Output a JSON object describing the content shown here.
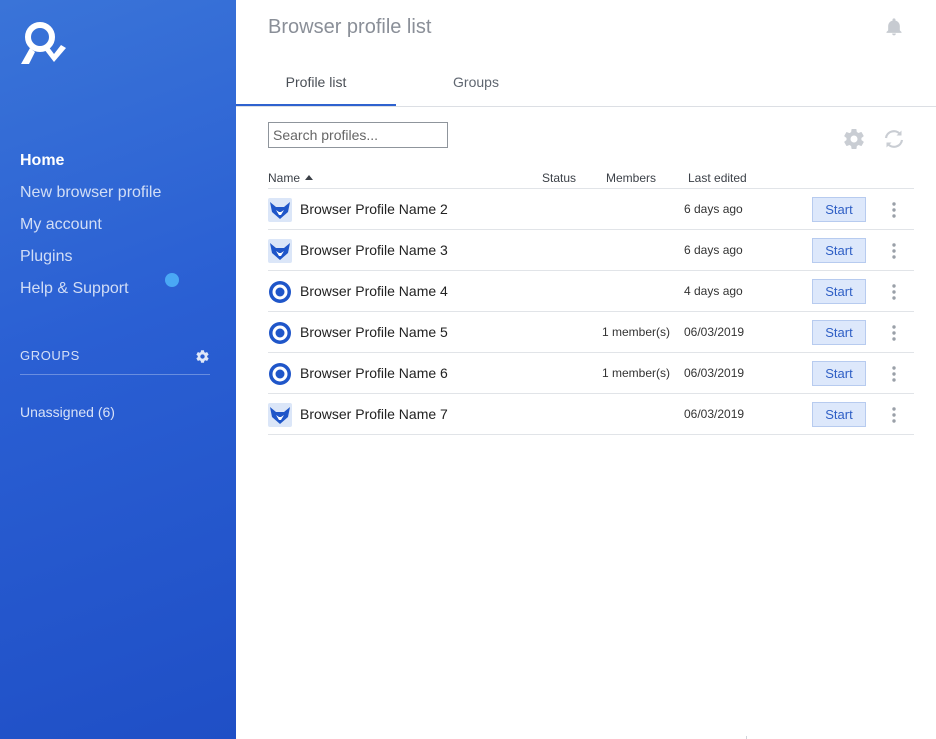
{
  "sidebar": {
    "nav": [
      {
        "label": "Home",
        "active": true
      },
      {
        "label": "New browser profile",
        "active": false
      },
      {
        "label": "My account",
        "active": false
      },
      {
        "label": "Plugins",
        "active": false
      },
      {
        "label": "Help & Support",
        "active": false
      }
    ],
    "groups_title": "GROUPS",
    "unassigned": "Unassigned (6)"
  },
  "header": {
    "title": "Browser profile list"
  },
  "tabs": [
    {
      "label": "Profile list",
      "active": true
    },
    {
      "label": "Groups",
      "active": false
    }
  ],
  "search": {
    "placeholder": "Search profiles..."
  },
  "table": {
    "columns": {
      "name": "Name",
      "status": "Status",
      "members": "Members",
      "edited": "Last edited"
    },
    "rows": [
      {
        "icon": "fox-icon",
        "name": "Browser Profile Name 2",
        "status": "",
        "members": "",
        "edited": "6 days ago",
        "action": "Start"
      },
      {
        "icon": "fox-icon",
        "name": "Browser Profile Name 3",
        "status": "",
        "members": "",
        "edited": "6 days ago",
        "action": "Start"
      },
      {
        "icon": "ring-icon",
        "name": "Browser Profile Name 4",
        "status": "",
        "members": "",
        "edited": "4 days ago",
        "action": "Start"
      },
      {
        "icon": "ring-icon",
        "name": "Browser Profile Name 5",
        "status": "",
        "members": "1 member(s)",
        "edited": "06/03/2019",
        "action": "Start"
      },
      {
        "icon": "ring-icon",
        "name": "Browser Profile Name 6",
        "status": "",
        "members": "1 member(s)",
        "edited": "06/03/2019",
        "action": "Start"
      },
      {
        "icon": "fox-icon",
        "name": "Browser Profile Name 7",
        "status": "",
        "members": "",
        "edited": "06/03/2019",
        "action": "Start"
      }
    ]
  },
  "colors": {
    "sidebar_top": "#3a74d8",
    "sidebar_bottom": "#1f4fc6",
    "accent": "#2e62cf",
    "button_bg": "#dde8fb"
  }
}
